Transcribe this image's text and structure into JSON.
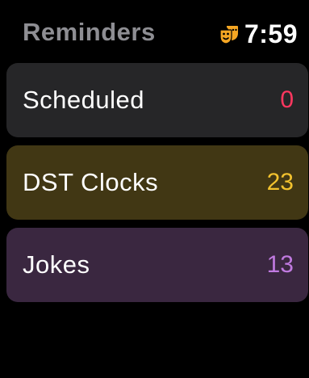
{
  "header": {
    "title": "Reminders",
    "time": "7:59",
    "status_icon": "theater-masks-icon"
  },
  "lists": [
    {
      "label": "Scheduled",
      "count": "0",
      "background": "#262628",
      "count_color": "#ff375f"
    },
    {
      "label": "DST Clocks",
      "count": "23",
      "background": "#413714",
      "count_color": "#f2c22e"
    },
    {
      "label": "Jokes",
      "count": "13",
      "background": "#3a2740",
      "count_color": "#c07ae0"
    }
  ],
  "colors": {
    "background": "#000000",
    "title": "#8e8e93",
    "time": "#ffffff",
    "icon": "#f5a623"
  }
}
